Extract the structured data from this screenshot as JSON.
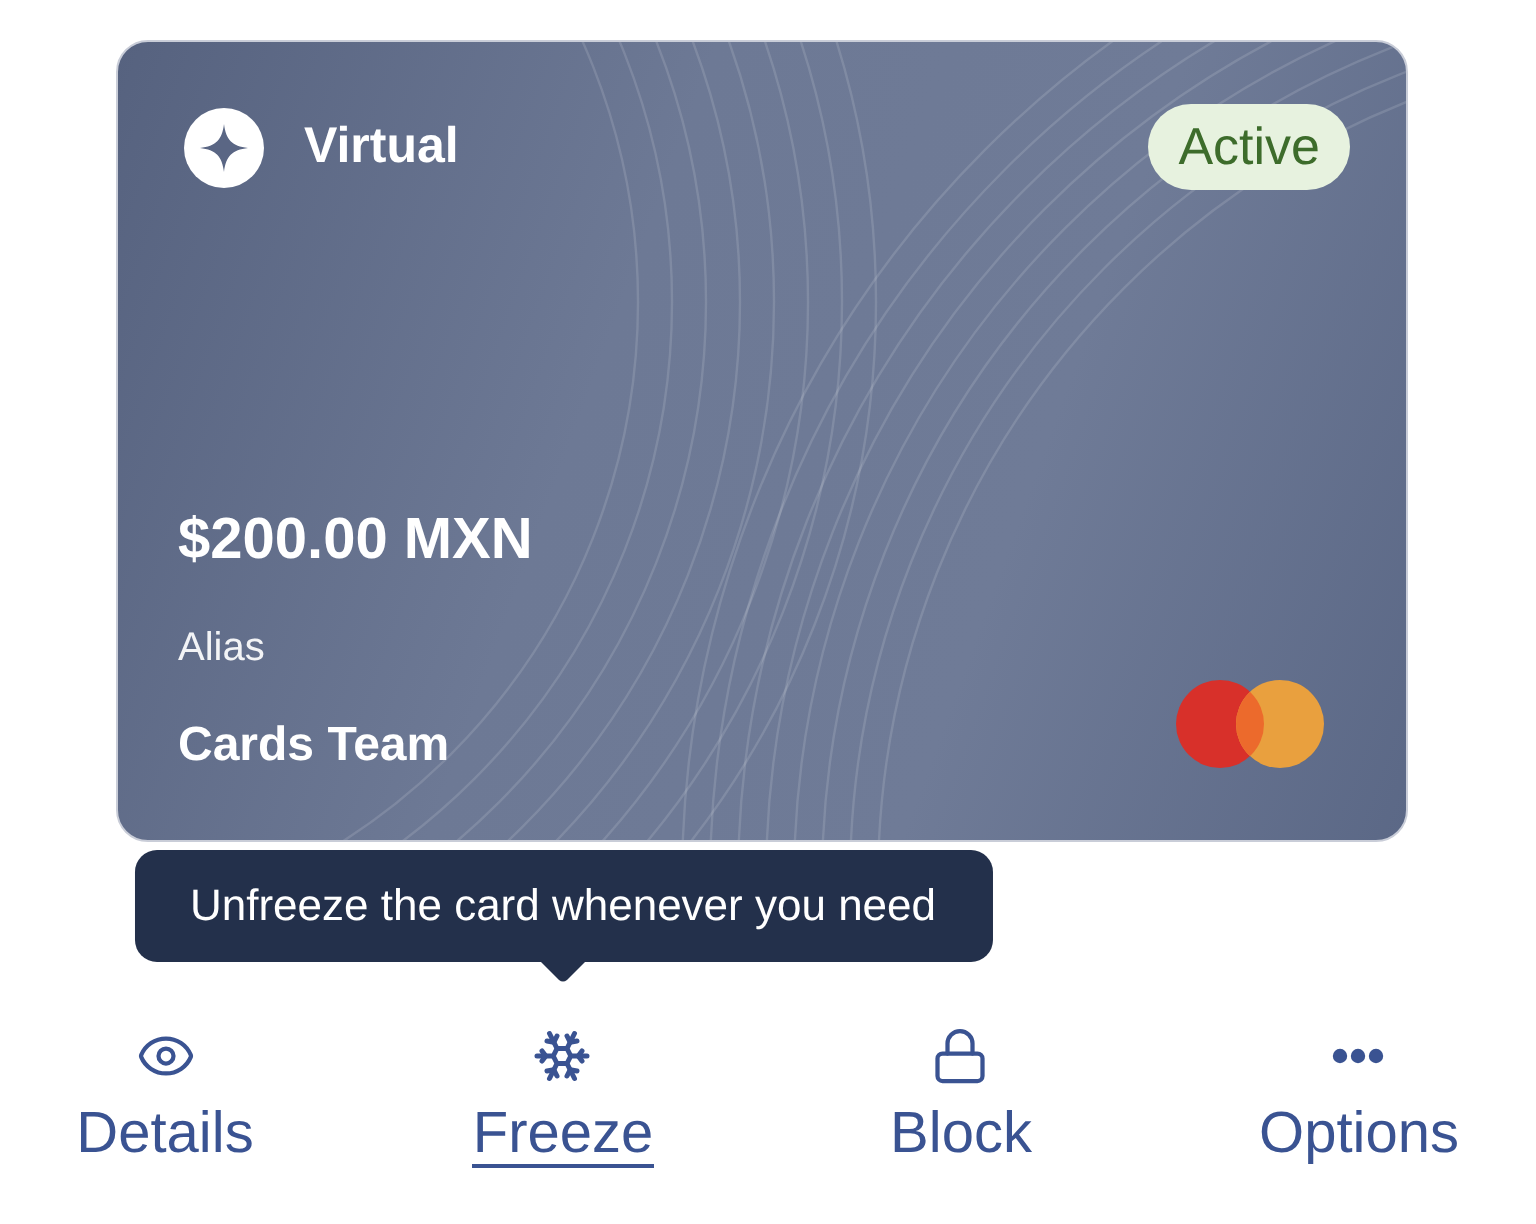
{
  "card": {
    "type": "Virtual",
    "status": "Active",
    "balance": "$200.00 MXN",
    "alias_label": "Alias",
    "alias": "Cards Team"
  },
  "tooltip": {
    "text": "Unfreeze the card whenever you need"
  },
  "actions": [
    {
      "kind": "details",
      "label": "Details",
      "selected": false
    },
    {
      "kind": "freeze",
      "label": "Freeze",
      "selected": true
    },
    {
      "kind": "block",
      "label": "Block",
      "selected": false
    },
    {
      "kind": "options",
      "label": "Options",
      "selected": false
    }
  ]
}
